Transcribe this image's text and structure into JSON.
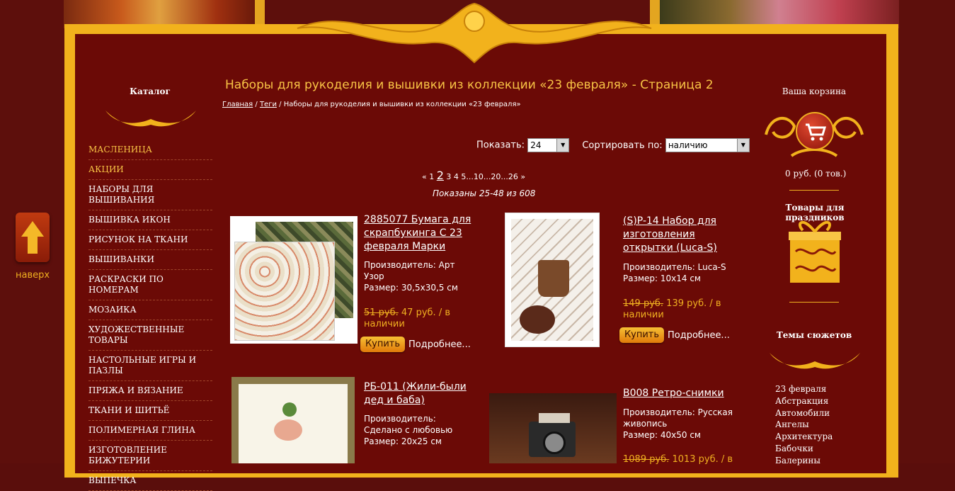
{
  "sidebar_left": {
    "heading": "Каталог",
    "items": [
      {
        "label": "МАСЛЕНИЦА",
        "highlight": true
      },
      {
        "label": "АКЦИИ",
        "highlight": true
      },
      {
        "label": "НАБОРЫ ДЛЯ ВЫШИВАНИЯ",
        "highlight": false
      },
      {
        "label": "ВЫШИВКА ИКОН",
        "highlight": false
      },
      {
        "label": "РИСУНОК НА ТКАНИ",
        "highlight": false
      },
      {
        "label": "ВЫШИВАНКИ",
        "highlight": false
      },
      {
        "label": "РАСКРАСКИ ПО НОМЕРАМ",
        "highlight": false
      },
      {
        "label": "МОЗАИКА",
        "highlight": false
      },
      {
        "label": "ХУДОЖЕСТВЕННЫЕ ТОВАРЫ",
        "highlight": false
      },
      {
        "label": "НАСТОЛЬНЫЕ ИГРЫ И ПАЗЛЫ",
        "highlight": false
      },
      {
        "label": "ПРЯЖА И ВЯЗАНИЕ",
        "highlight": false
      },
      {
        "label": "ТКАНИ И ШИТЬЁ",
        "highlight": false
      },
      {
        "label": "ПОЛИМЕРНАЯ ГЛИНА",
        "highlight": false
      },
      {
        "label": "ИЗГОТОВЛЕНИЕ БИЖУТЕРИИ",
        "highlight": false
      },
      {
        "label": "ВЫПЕЧКА",
        "highlight": false
      }
    ]
  },
  "to_top": {
    "label": "наверх",
    "icon": "arrow-up-icon"
  },
  "content": {
    "title": "Наборы для рукоделия и вышивки из коллекции «23 февраля» - Страница 2",
    "breadcrumb": {
      "home": "Главная",
      "sep": " / ",
      "tags": "Теги",
      "current": "Наборы для рукоделия и вышивки из коллекции «23 февраля»"
    },
    "show_label": "Показать:",
    "show_value": "24",
    "sort_label": "Сортировать по:",
    "sort_value": "наличию",
    "pagination": {
      "prev": "«",
      "p1": "1",
      "current": "2",
      "p3": "3",
      "p4": "4",
      "p5": "5",
      "dots1": "...",
      "p10": "10",
      "dots2": "...",
      "p20": "20",
      "dots3": "...",
      "p26": "26",
      "next": "»"
    },
    "shown_text": "Показаны 25-48 из 608",
    "products": [
      {
        "title": "2885077 Бумага для скрапбукинга С 23 февраля Марки",
        "maker": "Производитель: Арт Узор",
        "size": "Размер: 30,5x30,5 см",
        "old_price": "51 руб.",
        "price": " 47 руб. / в наличии",
        "buy": "Купить",
        "more": "Подробнее..."
      },
      {
        "title": "(S)P-14 Набор для изготовления открытки (Luca-S)",
        "maker": "Производитель: Luca-S",
        "size": "Размер: 10x14 см",
        "old_price": "149 руб.",
        "price": " 139 руб. / в наличии",
        "buy": "Купить",
        "more": "Подробнее..."
      },
      {
        "title": "РБ-011 (Жили-были дед и баба)",
        "maker": "Производитель: Сделано с любовью",
        "size": "Размер: 20x25 см"
      },
      {
        "title": "B008 Ретро-снимки",
        "maker": "Производитель: Русская живопись",
        "size": "Размер: 40x50 см",
        "old_price": "1089 руб.",
        "price": " 1013 руб. / в"
      }
    ]
  },
  "sidebar_right": {
    "cart_heading": "Ваша корзина",
    "cart_sum": "0 руб.   (0 тов.)",
    "holidays_heading": "Товары для праздников",
    "themes_heading": "Темы сюжетов",
    "themes": [
      "23 февраля",
      "Абстракция",
      "Автомобили",
      "Ангелы",
      "Архитектура",
      "Бабочки",
      "Балерины"
    ]
  },
  "colors": {
    "accent": "#f8c445",
    "frame": "#f2b21c",
    "bg": "#6b0a06"
  }
}
